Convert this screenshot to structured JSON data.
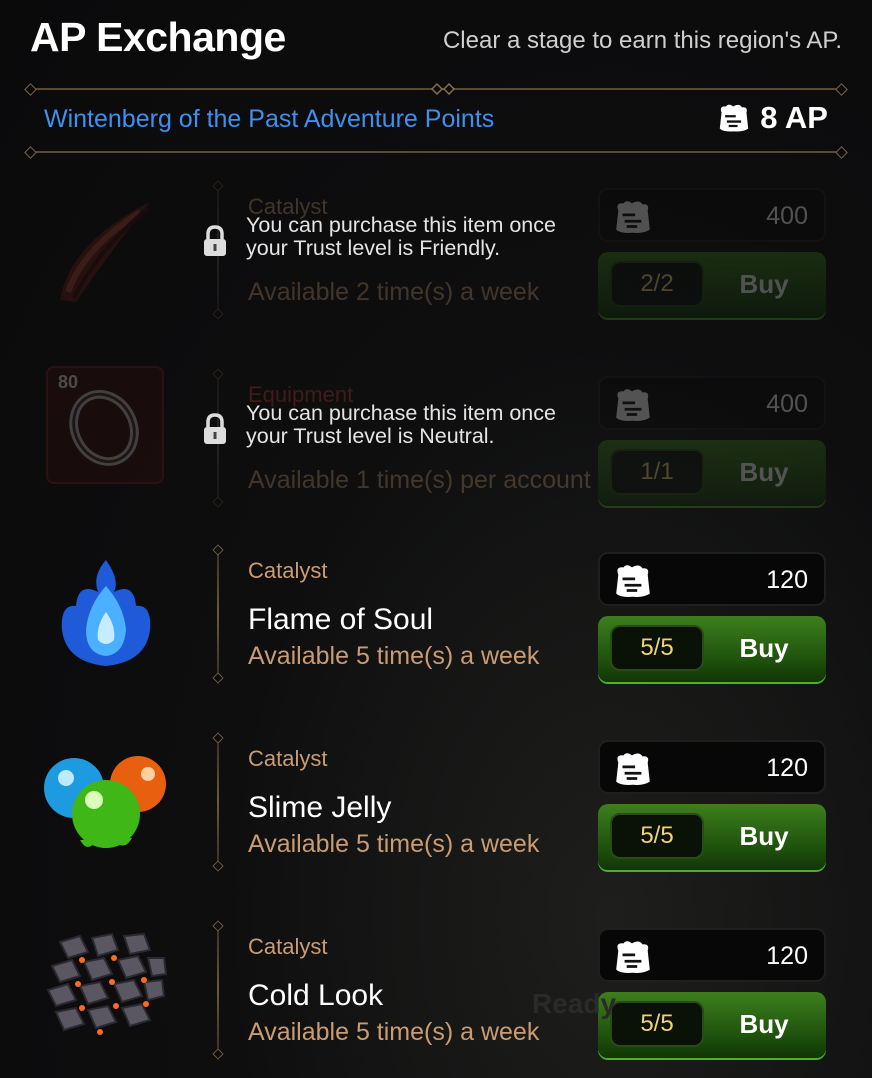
{
  "header": {
    "title": "AP Exchange",
    "hint": "Clear a stage to earn this region's AP.",
    "region_label": "Wintenberg of the Past Adventure Points",
    "ap_total": "8 AP",
    "ap_icon": "ap-bag-icon"
  },
  "buy_label": "Buy",
  "items": [
    {
      "category": "Catalyst",
      "name": "",
      "availability": "Available 2 time(s) a week",
      "price": "400",
      "count": "2/2",
      "locked": true,
      "lock_message": "You can purchase this item once your Trust level is Friendly.",
      "icon": "braided-horn-icon"
    },
    {
      "category": "Equipment",
      "name": "",
      "availability": "Available 1 time(s) per account",
      "price": "400",
      "count": "1/1",
      "locked": true,
      "lock_message": "You can purchase this item once your Trust level is Neutral.",
      "icon": "ring-icon",
      "level_badge": "80"
    },
    {
      "category": "Catalyst",
      "name": "Flame of Soul",
      "availability": "Available 5 time(s) a week",
      "price": "120",
      "count": "5/5",
      "locked": false,
      "icon": "blue-flame-icon"
    },
    {
      "category": "Catalyst",
      "name": "Slime Jelly",
      "availability": "Available 5 time(s) a week",
      "price": "120",
      "count": "5/5",
      "locked": false,
      "icon": "slime-jelly-icon"
    },
    {
      "category": "Catalyst",
      "name": "Cold Look",
      "availability": "Available 5 time(s) a week",
      "price": "120",
      "count": "5/5",
      "locked": false,
      "icon": "stone-scales-icon"
    }
  ],
  "background_text": "Ready",
  "colors": {
    "region_blue": "#3f8ff0",
    "category_tan": "#c99c73",
    "count_gold": "#f0d07a",
    "buy_green": "#3d7f1d"
  }
}
